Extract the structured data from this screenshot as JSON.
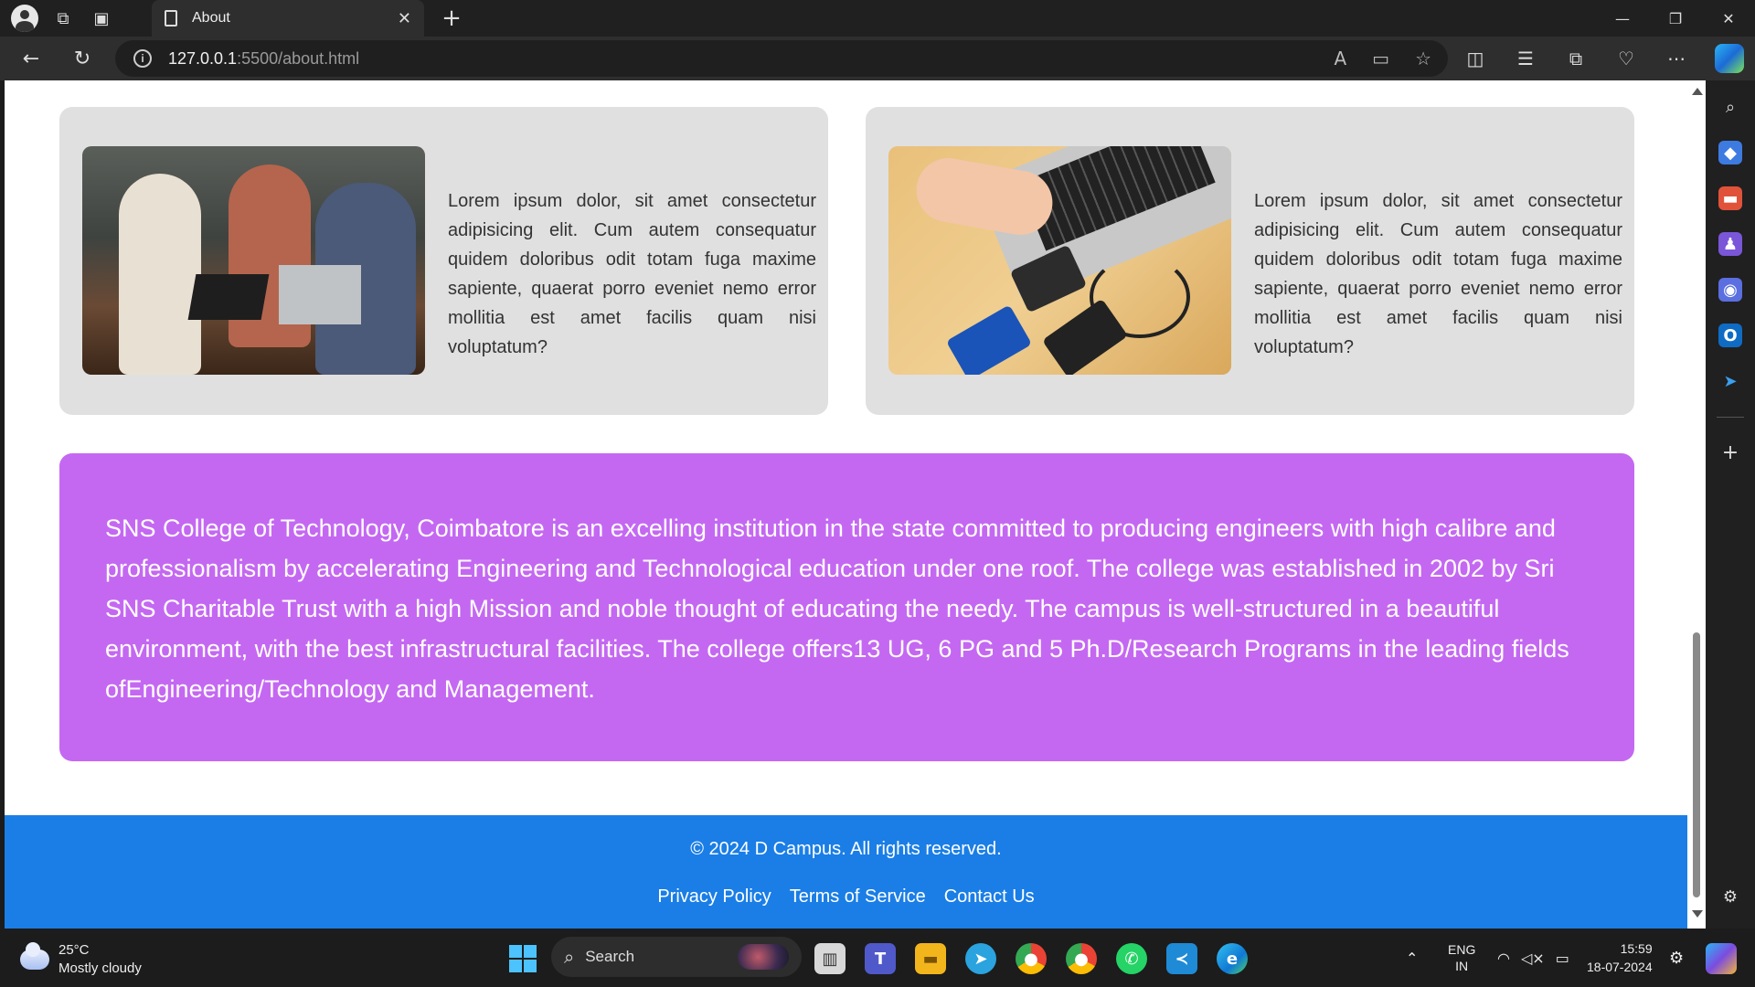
{
  "browser": {
    "tab_title": "About",
    "url_host": "127.0.0.1",
    "url_path": ":5500/about.html"
  },
  "cards": [
    {
      "text": "Lorem ipsum dolor, sit amet consectetur adipisicing elit. Cum autem consequatur quidem doloribus odit totam fuga maxime sapiente, quaerat porro eveniet nemo error mollitia est amet facilis quam nisi voluptatum?"
    },
    {
      "text": "Lorem ipsum dolor, sit amet consectetur adipisicing elit. Cum autem consequatur quidem doloribus odit totam fuga maxime sapiente, quaerat porro eveniet nemo error mollitia est amet facilis quam nisi voluptatum?"
    }
  ],
  "banner": {
    "text": "SNS College of Technology, Coimbatore is an excelling institution in the state committed to producing engineers with high calibre and professionalism by accelerating Engineering and Technological education under one roof. The college was established in 2002 by Sri SNS Charitable Trust with a high Mission and noble thought of educating the needy. The campus is well-structured in a beautiful environment, with the best infrastructural facilities. The college offers13 UG, 6 PG and 5 Ph.D/Research Programs in the leading fields ofEngineering/Technology and Management."
  },
  "footer": {
    "copyright": "© 2024 D Campus. All rights reserved.",
    "links": [
      "Privacy Policy",
      "Terms of Service",
      "Contact Us"
    ]
  },
  "taskbar": {
    "temperature": "25°C",
    "condition": "Mostly cloudy",
    "search_label": "Search",
    "lang_top": "ENG",
    "lang_bottom": "IN",
    "time": "15:59",
    "date": "18-07-2024"
  },
  "colors": {
    "banner": "#c468f2",
    "footer": "#1a7ee6",
    "card": "#e0e0e0"
  }
}
